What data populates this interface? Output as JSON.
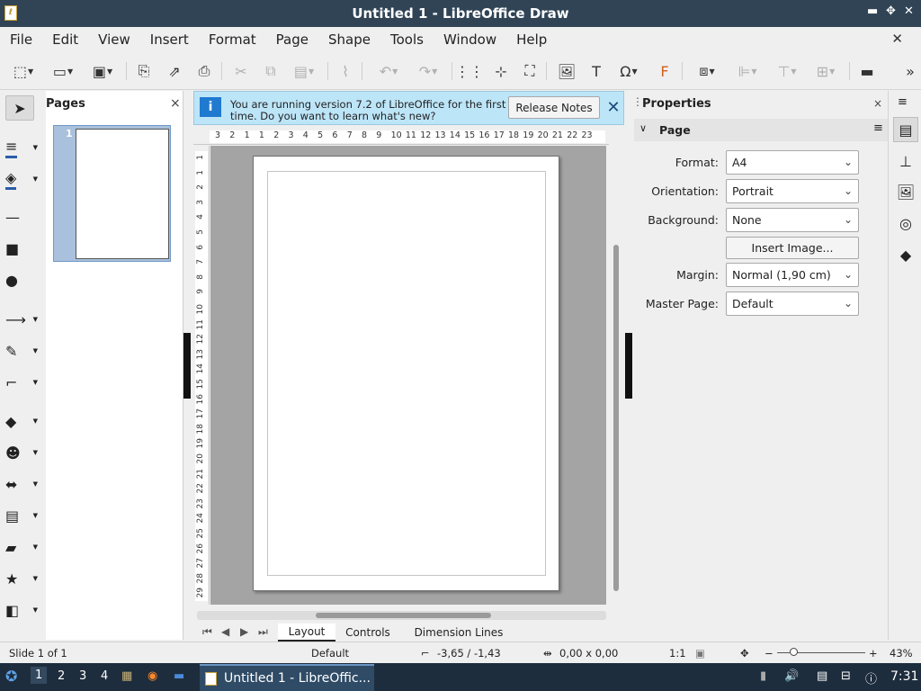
{
  "window": {
    "title": "Untitled 1 - LibreOffice Draw",
    "minimize": "▬",
    "maximize": "✥",
    "close": "✕"
  },
  "menu": {
    "items": [
      "File",
      "Edit",
      "View",
      "Insert",
      "Format",
      "Page",
      "Shape",
      "Tools",
      "Window",
      "Help"
    ],
    "close_doc": "✕"
  },
  "toolbar": {
    "icons": [
      "new-icon",
      "open-icon",
      "save-icon",
      "export-icon",
      "export-pdf-icon",
      "print-icon",
      "cut-icon",
      "copy-icon",
      "paste-icon",
      "clone-formatting-icon",
      "undo-icon",
      "redo-icon",
      "grid-icon",
      "helplines-icon",
      "zoom-pan-icon",
      "image-icon",
      "textbox-icon",
      "special-character-icon",
      "fontwork-icon",
      "transformations-icon",
      "align-icon",
      "arrange-icon",
      "distribute-icon",
      "shadow-icon",
      "more-icon"
    ]
  },
  "left_tools": {
    "icons": [
      "select-icon",
      "line-color-icon",
      "fill-color-icon",
      "line-icon",
      "rectangle-icon",
      "ellipse-icon",
      "arrow-line-icon",
      "curve-icon",
      "connector-icon",
      "basic-shapes-icon",
      "symbol-shapes-icon",
      "block-arrows-icon",
      "flowchart-icon",
      "callout-icon",
      "star-icon",
      "3d-object-icon"
    ]
  },
  "pages_panel": {
    "title": "Pages",
    "close": "×",
    "thumb_number": "1"
  },
  "infobar": {
    "message": "You are running version 7.2 of LibreOffice for the first time. Do you want to learn what's new?",
    "button": "Release Notes",
    "close": "✕"
  },
  "ruler": {
    "h_ticks": [
      "3",
      "2",
      "1",
      "1",
      "2",
      "3",
      "4",
      "5",
      "6",
      "7",
      "8",
      "9",
      "10",
      "11",
      "12",
      "13",
      "14",
      "15",
      "16",
      "17",
      "18",
      "19",
      "20",
      "21",
      "22",
      "23"
    ],
    "v_ticks": [
      "1",
      "1",
      "2",
      "3",
      "4",
      "5",
      "6",
      "7",
      "8",
      "9",
      "10",
      "11",
      "12",
      "13",
      "14",
      "15",
      "16",
      "17",
      "18",
      "19",
      "20",
      "21",
      "22",
      "23",
      "24",
      "25",
      "26",
      "27",
      "28",
      "29"
    ]
  },
  "tabs": {
    "items": [
      "Layout",
      "Controls",
      "Dimension Lines"
    ],
    "active": "Layout"
  },
  "properties": {
    "title": "Properties",
    "close": "×",
    "menu": "≡",
    "section": "Page",
    "format_label": "Format:",
    "format_value": "A4",
    "orientation_label": "Orientation:",
    "orientation_value": "Portrait",
    "background_label": "Background:",
    "background_value": "None",
    "insert_image": "Insert Image...",
    "margin_label": "Margin:",
    "margin_value": "Normal (1,90 cm)",
    "master_label": "Master Page:",
    "master_value": "Default"
  },
  "statusbar": {
    "slide": "Slide 1 of 1",
    "master": "Default",
    "position": "-3,65 / -1,43",
    "size": "0,00 x 0,00",
    "scale": "1:1",
    "zoom_minus": "−",
    "zoom_plus": "+",
    "zoom": "43%"
  },
  "taskbar": {
    "workspaces": [
      "1",
      "2",
      "3",
      "4"
    ],
    "active_task": "Untitled 1 - LibreOffic...",
    "clock": "7:31"
  },
  "colors": {
    "titlebar": "#304456",
    "infobar": "#bde5f8",
    "taskbar": "#1e2d3d"
  }
}
